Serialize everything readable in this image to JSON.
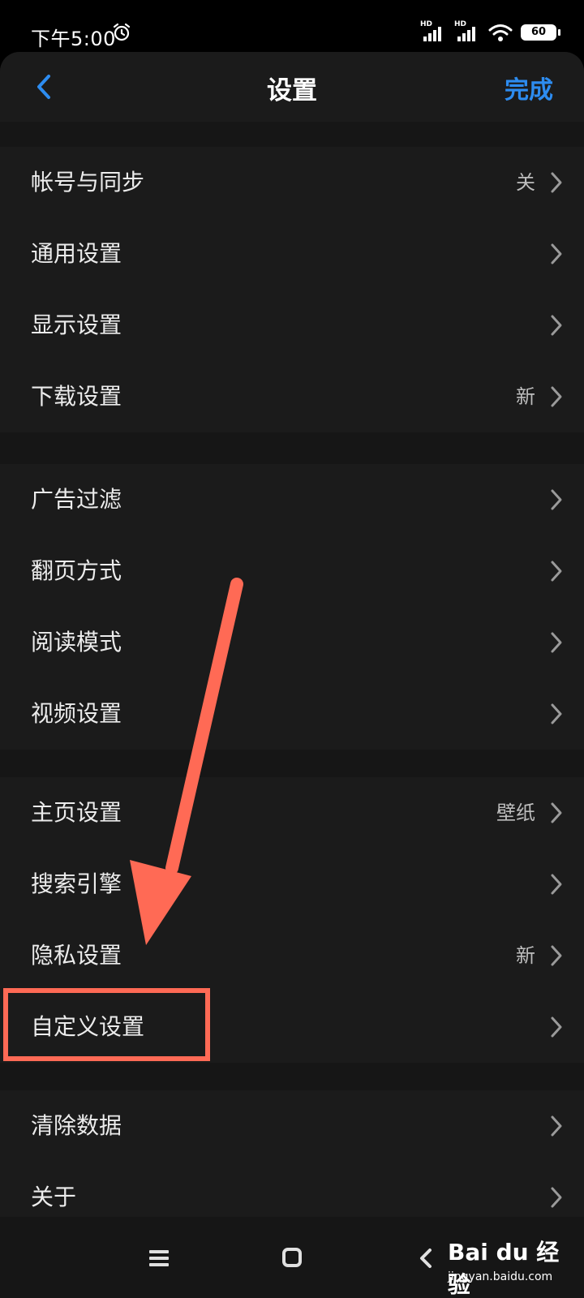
{
  "status_bar": {
    "time": "下午5:00",
    "hd1": "HD",
    "hd2": "HD",
    "battery": "60"
  },
  "header": {
    "title": "设置",
    "done_label": "完成"
  },
  "sections": [
    [
      {
        "label": "帐号与同步",
        "value": "关"
      },
      {
        "label": "通用设置",
        "value": ""
      },
      {
        "label": "显示设置",
        "value": ""
      },
      {
        "label": "下载设置",
        "value": "新"
      }
    ],
    [
      {
        "label": "广告过滤",
        "value": ""
      },
      {
        "label": "翻页方式",
        "value": ""
      },
      {
        "label": "阅读模式",
        "value": ""
      },
      {
        "label": "视频设置",
        "value": ""
      }
    ],
    [
      {
        "label": "主页设置",
        "value": "壁纸"
      },
      {
        "label": "搜索引擎",
        "value": ""
      },
      {
        "label": "隐私设置",
        "value": "新"
      },
      {
        "label": "自定义设置",
        "value": ""
      }
    ],
    [
      {
        "label": "清除数据",
        "value": ""
      },
      {
        "label": "关于",
        "value": ""
      }
    ]
  ],
  "watermark": {
    "brand": "Bai du 经验",
    "url": "jingyan.baidu.com"
  },
  "colors": {
    "accent": "#2d8cf0",
    "annotation": "#ff6a55",
    "background": "#161616",
    "row_background": "#1b1b1b"
  }
}
